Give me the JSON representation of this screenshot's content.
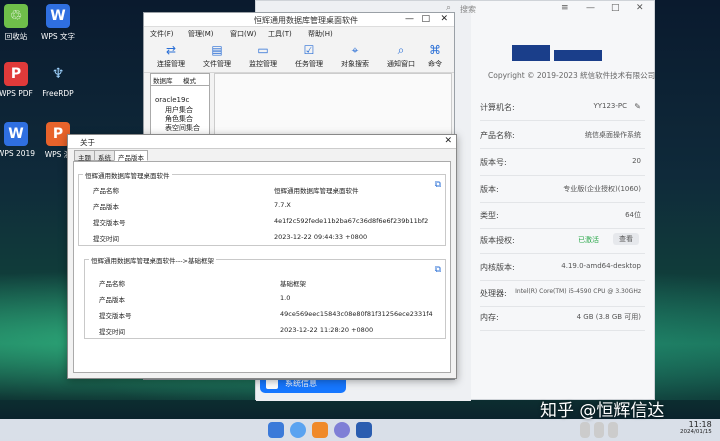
{
  "desktop": {
    "icons": [
      {
        "label": "回收站"
      },
      {
        "label": "WPS 文字"
      },
      {
        "label": "WPS PDF"
      },
      {
        "label": "FreeRDP"
      },
      {
        "label": "WPS 2019"
      },
      {
        "label": "WPS 演"
      }
    ]
  },
  "sysinfo": {
    "search_placeholder": "搜索",
    "copyright": "Copyright © 2019-2023 統信软件技术有限公司",
    "rows": [
      {
        "key": "计算机名:",
        "value": "YY123-PC"
      },
      {
        "key": "产品名称:",
        "value": "统信桌面操作系统"
      },
      {
        "key": "版本号:",
        "value": "20"
      },
      {
        "key": "版本:",
        "value": "专业版(企业授权)(1060)"
      },
      {
        "key": "类型:",
        "value": "64位"
      },
      {
        "key": "版本授权:",
        "value": "已激活",
        "button": "查看"
      },
      {
        "key": "内核版本:",
        "value": "4.19.0-amd64-desktop"
      },
      {
        "key": "处理器:",
        "value": "Intel(R) Core(TM) i5-4590 CPU @ 3.30GHz"
      },
      {
        "key": "内存:",
        "value": "4 GB (3.8 GB 可用)"
      }
    ],
    "sidebar_selected": "系统信息"
  },
  "manager": {
    "title": "恒辉通用数据库管理桌面软件",
    "menu": [
      "文件(F)",
      "管理(M)",
      "窗口(W)",
      "工具(T)",
      "帮助(H)"
    ],
    "toolbar": [
      "连接管理",
      "文件管理",
      "监控管理",
      "任务管理",
      "对象搜索",
      "通知窗口",
      "命令"
    ],
    "nav_tabs": [
      "数据库",
      "模式"
    ],
    "tree": [
      "oracle19c",
      "用户集合",
      "角色集合",
      "表空间集合"
    ]
  },
  "about": {
    "title": "关于",
    "tabs": [
      "主题",
      "系统",
      "产品版本"
    ],
    "group1": {
      "title": "恒辉通用数据库管理桌面软件",
      "rows": [
        {
          "k": "产品名称",
          "v": "恒辉通用数据库管理桌面软件"
        },
        {
          "k": "产品版本",
          "v": "7.7.X"
        },
        {
          "k": "提交版本号",
          "v": "4e1f2c592fede11b2ba67c36d8f6e6f239b11bf2"
        },
        {
          "k": "提交时间",
          "v": "2023-12-22 09:44:33 +0800"
        }
      ]
    },
    "group2": {
      "title": "恒辉通用数据库管理桌面软件--->基础框架",
      "rows": [
        {
          "k": "产品名称",
          "v": "基础框架"
        },
        {
          "k": "产品版本",
          "v": "1.0"
        },
        {
          "k": "提交版本号",
          "v": "49ce569eec15843c08e80f81f31256ece2331f4"
        },
        {
          "k": "提交时间",
          "v": "2023-12-22 11:28:20 +0800"
        }
      ]
    }
  },
  "watermark": "知乎 @恒辉信达",
  "clock": {
    "time": "11:18",
    "date": "2024/01/15"
  }
}
